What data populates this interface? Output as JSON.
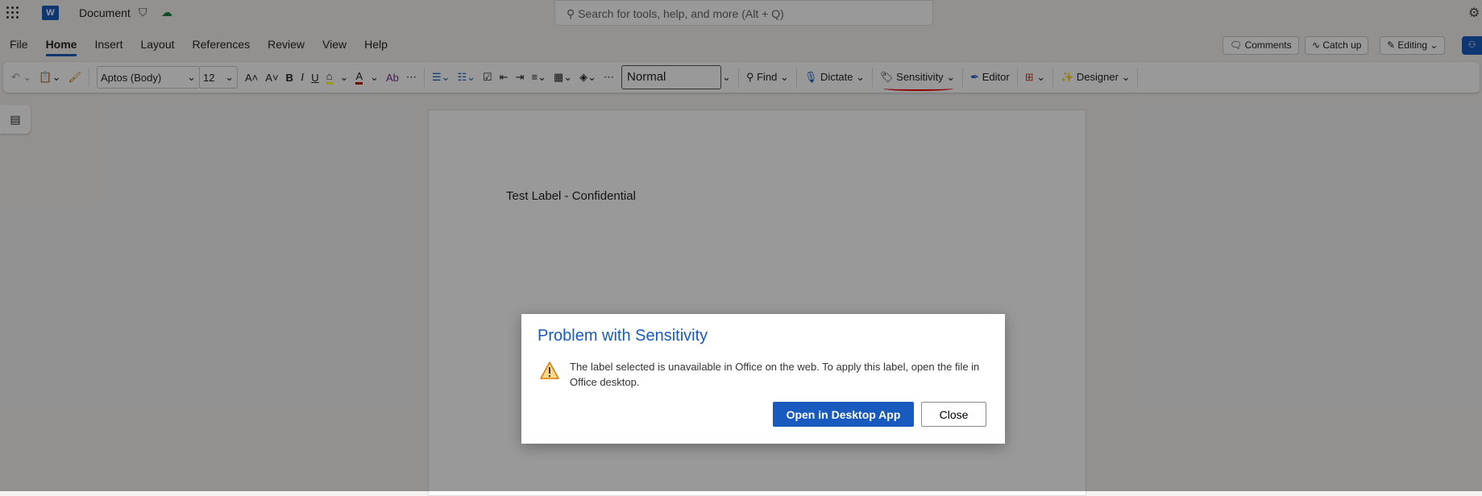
{
  "titlebar": {
    "doc_name": "Document",
    "search_placeholder": "Search for tools, help, and more (Alt + Q)"
  },
  "tabs": [
    "File",
    "Home",
    "Insert",
    "Layout",
    "References",
    "Review",
    "View",
    "Help"
  ],
  "right_buttons": {
    "comments": "Comments",
    "catch_up": "Catch up",
    "editing": "Editing"
  },
  "ribbon": {
    "font": "Aptos (Body)",
    "size": "12",
    "style": "Normal",
    "find": "Find",
    "dictate": "Dictate",
    "sensitivity": "Sensitivity",
    "editor": "Editor",
    "designer": "Designer"
  },
  "document": {
    "text": "Test Label - Confidential"
  },
  "dialog": {
    "title": "Problem with Sensitivity",
    "message": "The label selected is unavailable in Office on the web. To apply this label, open the file in Office desktop.",
    "primary": "Open in Desktop App",
    "close": "Close"
  },
  "colors": {
    "accent": "#185abd",
    "annotation": "#e00000"
  }
}
